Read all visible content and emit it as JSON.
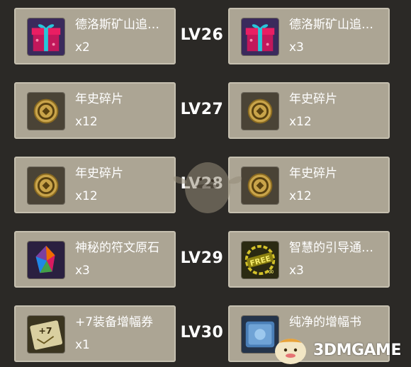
{
  "rewards": [
    {
      "level": "LV26",
      "left": {
        "name": "德洛斯矿山追…",
        "qty": "x2",
        "icon": "gift-box-icon"
      },
      "right": {
        "name": "德洛斯矿山追…",
        "qty": "x3",
        "icon": "gift-box-icon"
      }
    },
    {
      "level": "LV27",
      "left": {
        "name": "年史碎片",
        "qty": "x12",
        "icon": "coin-icon"
      },
      "right": {
        "name": "年史碎片",
        "qty": "x12",
        "icon": "coin-icon"
      }
    },
    {
      "level": "LV28",
      "left": {
        "name": "年史碎片",
        "qty": "x12",
        "icon": "coin-icon"
      },
      "right": {
        "name": "年史碎片",
        "qty": "x12",
        "icon": "coin-icon"
      }
    },
    {
      "level": "LV29",
      "left": {
        "name": "神秘的符文原石",
        "qty": "x3",
        "icon": "rune-stone-icon"
      },
      "right": {
        "name": "智慧的引导通…",
        "qty": "x3",
        "icon": "free-pass-icon"
      }
    },
    {
      "level": "LV30",
      "left": {
        "name": "+7装备增幅券",
        "qty": "x1",
        "icon": "plus7-ticket-icon"
      },
      "right": {
        "name": "纯净的增幅书",
        "qty": "",
        "icon": "blue-book-icon"
      }
    }
  ],
  "watermark": {
    "text": "3DMGAME"
  }
}
